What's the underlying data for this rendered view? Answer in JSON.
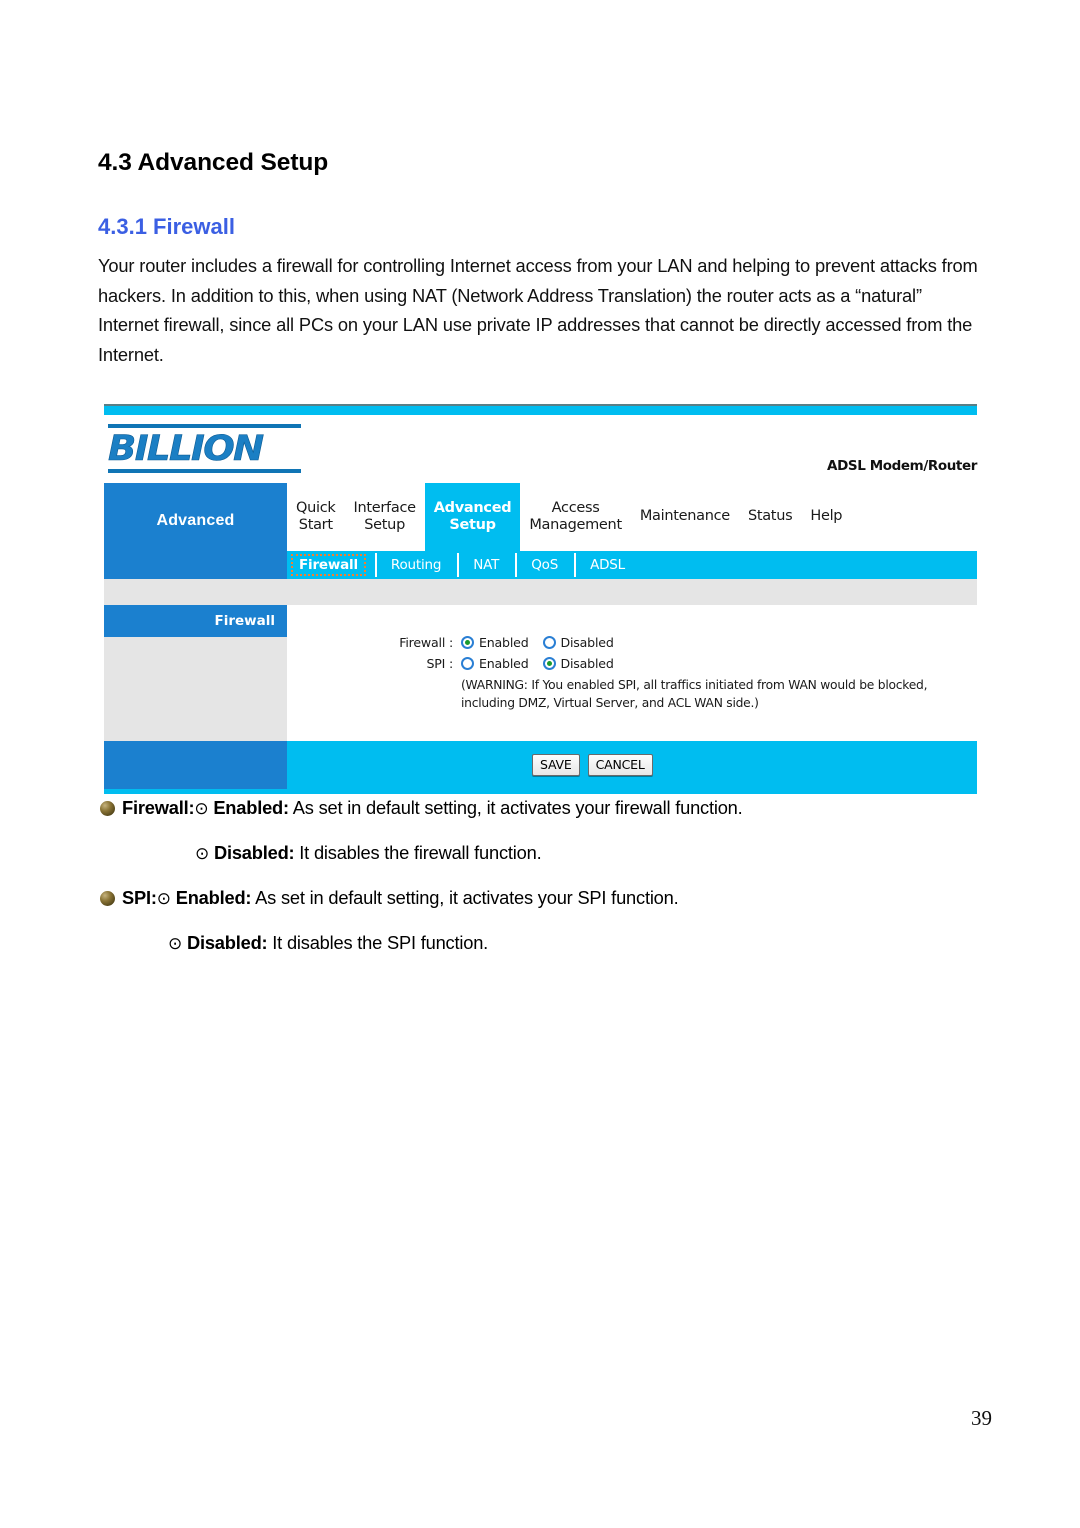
{
  "document": {
    "section_heading": "4.3 Advanced Setup",
    "subsection_heading": "4.3.1 Firewall",
    "intro_paragraph": "Your router includes a firewall for controlling Internet access from your LAN and helping to prevent attacks from hackers. In addition to this, when using NAT (Network Address Translation) the router acts as a “natural” Internet firewall, since all PCs on your LAN use private IP addresses that cannot be directly accessed from the Internet.",
    "page_number": "39"
  },
  "router_ui": {
    "brand": "BILLION",
    "model": "ADSL Modem/Router",
    "sidebar_title": "Advanced",
    "main_tabs": [
      {
        "label": "Quick\nStart",
        "line1": "Quick",
        "line2": "Start",
        "active": false
      },
      {
        "label": "Interface Setup",
        "line1": "Interface",
        "line2": "Setup",
        "active": false
      },
      {
        "label": "Advanced Setup",
        "line1": "Advanced",
        "line2": "Setup",
        "active": true
      },
      {
        "label": "Access Management",
        "line1": "Access",
        "line2": "Management",
        "active": false
      },
      {
        "label": "Maintenance",
        "line1": "Maintenance",
        "line2": "",
        "active": false
      },
      {
        "label": "Status",
        "line1": "Status",
        "line2": "",
        "active": false
      },
      {
        "label": "Help",
        "line1": "Help",
        "line2": "",
        "active": false
      }
    ],
    "sub_tabs": [
      {
        "label": "Firewall",
        "active": true
      },
      {
        "label": "Routing",
        "active": false
      },
      {
        "label": "NAT",
        "active": false
      },
      {
        "label": "QoS",
        "active": false
      },
      {
        "label": "ADSL",
        "active": false
      }
    ],
    "panel_title": "Firewall",
    "fields": [
      {
        "label": "Firewall :",
        "options": [
          {
            "label": "Enabled",
            "selected": true
          },
          {
            "label": "Disabled",
            "selected": false
          }
        ]
      },
      {
        "label": "SPI :",
        "options": [
          {
            "label": "Enabled",
            "selected": false
          },
          {
            "label": "Disabled",
            "selected": true
          }
        ]
      }
    ],
    "warning": "(WARNING: If You enabled SPI, all traffics initiated from WAN would be blocked, including DMZ, Virtual Server, and ACL WAN side.)",
    "buttons": {
      "save": "SAVE",
      "cancel": "CANCEL"
    },
    "colors": {
      "cyan": "#00bdf0",
      "blue": "#1b80cf",
      "grey": "#e5e5e5",
      "logo_blue": "#1b7fc4",
      "focus_outline": "#f08030",
      "radio_ring": "#2a7fd4",
      "radio_dot": "#1a9a30"
    }
  },
  "bullets": [
    {
      "marker": "sphere",
      "term": "Firewall:",
      "radio_glyph": "⊙",
      "option": "Enabled:",
      "description": " As set in default setting, it activates your firewall function."
    },
    {
      "marker": "none",
      "radio_glyph": "⊙",
      "option": "Disabled:",
      "description": " It disables the firewall function."
    },
    {
      "marker": "sphere",
      "term": "SPI:",
      "radio_glyph": "⊙",
      "option": "Enabled:",
      "description": " As set in default setting, it activates your SPI function."
    },
    {
      "marker": "none",
      "radio_glyph": "⊙",
      "option": "Disabled:",
      "description": " It disables the SPI function."
    }
  ]
}
